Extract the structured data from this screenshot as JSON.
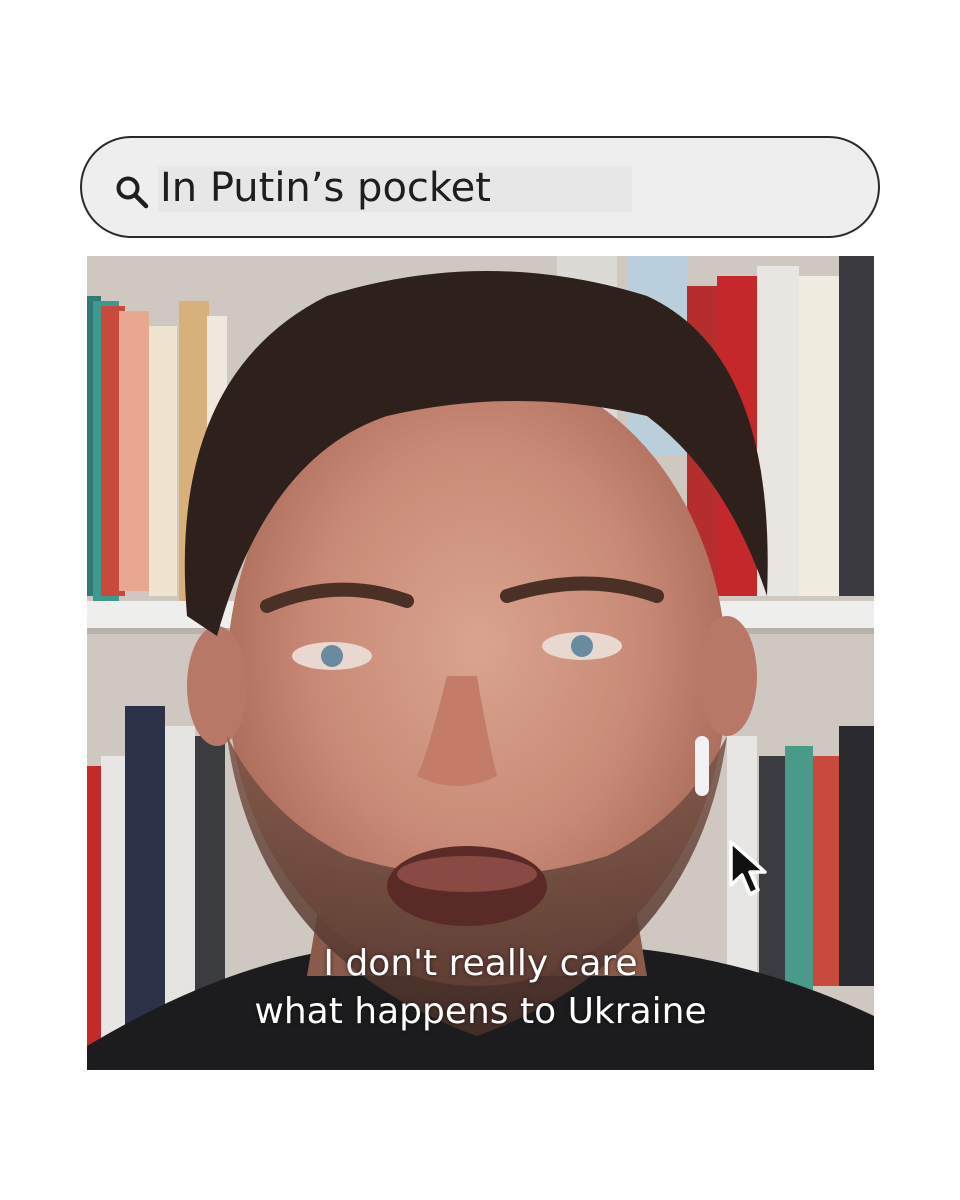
{
  "search": {
    "query": "In Putin’s pocket",
    "icon": "search-icon"
  },
  "video": {
    "caption_line_1": "I don't really care",
    "caption_line_2": "what happens to Ukraine",
    "cursor_icon": "mouse-pointer-icon"
  },
  "colors": {
    "search_bg": "#eeeeee",
    "search_border": "#2a2a2a",
    "caption_text": "#ffffff"
  }
}
